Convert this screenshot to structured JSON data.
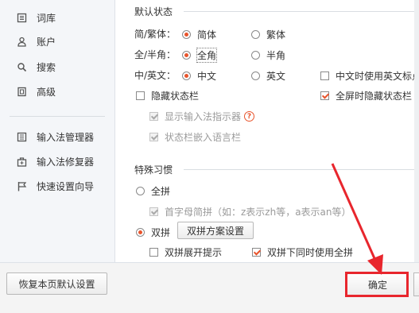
{
  "sidebar": {
    "items": [
      {
        "label": "词库",
        "icon": "dictionary-icon"
      },
      {
        "label": "账户",
        "icon": "user-icon"
      },
      {
        "label": "搜索",
        "icon": "search-icon"
      },
      {
        "label": "高级",
        "icon": "advanced-icon"
      }
    ],
    "tools": [
      {
        "label": "输入法管理器",
        "icon": "manager-icon"
      },
      {
        "label": "输入法修复器",
        "icon": "repair-icon"
      },
      {
        "label": "快速设置向导",
        "icon": "flag-icon"
      }
    ]
  },
  "default_state": {
    "title": "默认状态",
    "simp_trad": {
      "label": "简/繁体：",
      "opt1": "简体",
      "opt2": "繁体",
      "selected": "简体"
    },
    "full_half": {
      "label": "全/半角：",
      "opt1": "全角",
      "opt2": "半角",
      "selected": "全角"
    },
    "cn_en": {
      "label": "中/英文：",
      "opt1": "中文",
      "opt2": "英文",
      "selected": "中文",
      "extra_check": "中文时使用英文标点"
    },
    "hide_statusbar": "隐藏状态栏",
    "fullscreen_hide": "全屏时隐藏状态栏",
    "show_indicator": "显示输入法指示器",
    "help_glyph": "?",
    "embed_langbar": "状态栏嵌入语言栏"
  },
  "special_habits": {
    "title": "特殊习惯",
    "full_pinyin": "全拼",
    "initials": "首字母简拼（如：z表示zh等，a表示an等）",
    "double_pinyin": "双拼",
    "scheme_button": "双拼方案设置",
    "expand_hint": "双拼展开提示",
    "use_full_too": "双拼下同时使用全拼"
  },
  "footer": {
    "restore_button": "恢复本页默认设置",
    "ok_button": "确定"
  },
  "colors": {
    "accent": "#e8542c",
    "annotation": "#e8262d"
  }
}
